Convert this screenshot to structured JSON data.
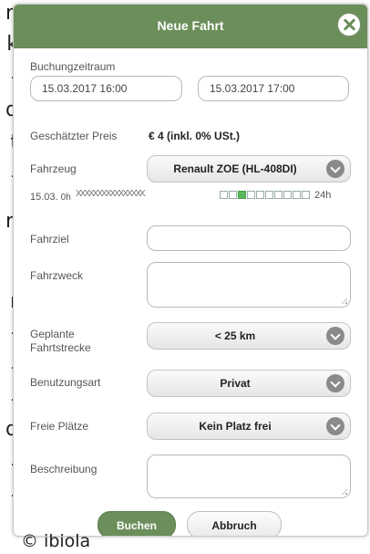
{
  "background_text": [
    "n",
    "k",
    "-",
    "d",
    "t",
    "-",
    "n",
    "r",
    "-",
    "-",
    "-",
    "d",
    "-",
    "-"
  ],
  "dialog": {
    "title": "Neue Fahrt",
    "close_icon": "close-icon",
    "accent_color": "#6b8e5a",
    "booking_period": {
      "label": "Buchungzeitraum",
      "start": "15.03.2017 16:00",
      "end": "15.03.2017 17:00"
    },
    "price": {
      "label": "Geschätzter Preis",
      "value": "€ 4 (inkl. 0% USt.)"
    },
    "vehicle": {
      "label": "Fahrzeug",
      "value": "Renault ZOE (HL-408DI)"
    },
    "availability": {
      "date": "15.03.",
      "start": "0h",
      "end": "24h",
      "x_marks": "XXXXXXXXXXXXXXXX"
    },
    "destination": {
      "label": "Fahrziel",
      "value": ""
    },
    "purpose": {
      "label": "Fahrzweck",
      "value": ""
    },
    "planned_distance": {
      "label_line1": "Geplante",
      "label_line2": "Fahrtstrecke",
      "value": "< 25 km"
    },
    "usage_type": {
      "label": "Benutzungsart",
      "value": "Privat"
    },
    "free_seats": {
      "label": "Freie Plätze",
      "value": "Kein Platz frei"
    },
    "description": {
      "label": "Beschreibung",
      "value": ""
    },
    "buttons": {
      "book": "Buchen",
      "cancel": "Abbruch"
    }
  },
  "copyright": "© ibiola"
}
